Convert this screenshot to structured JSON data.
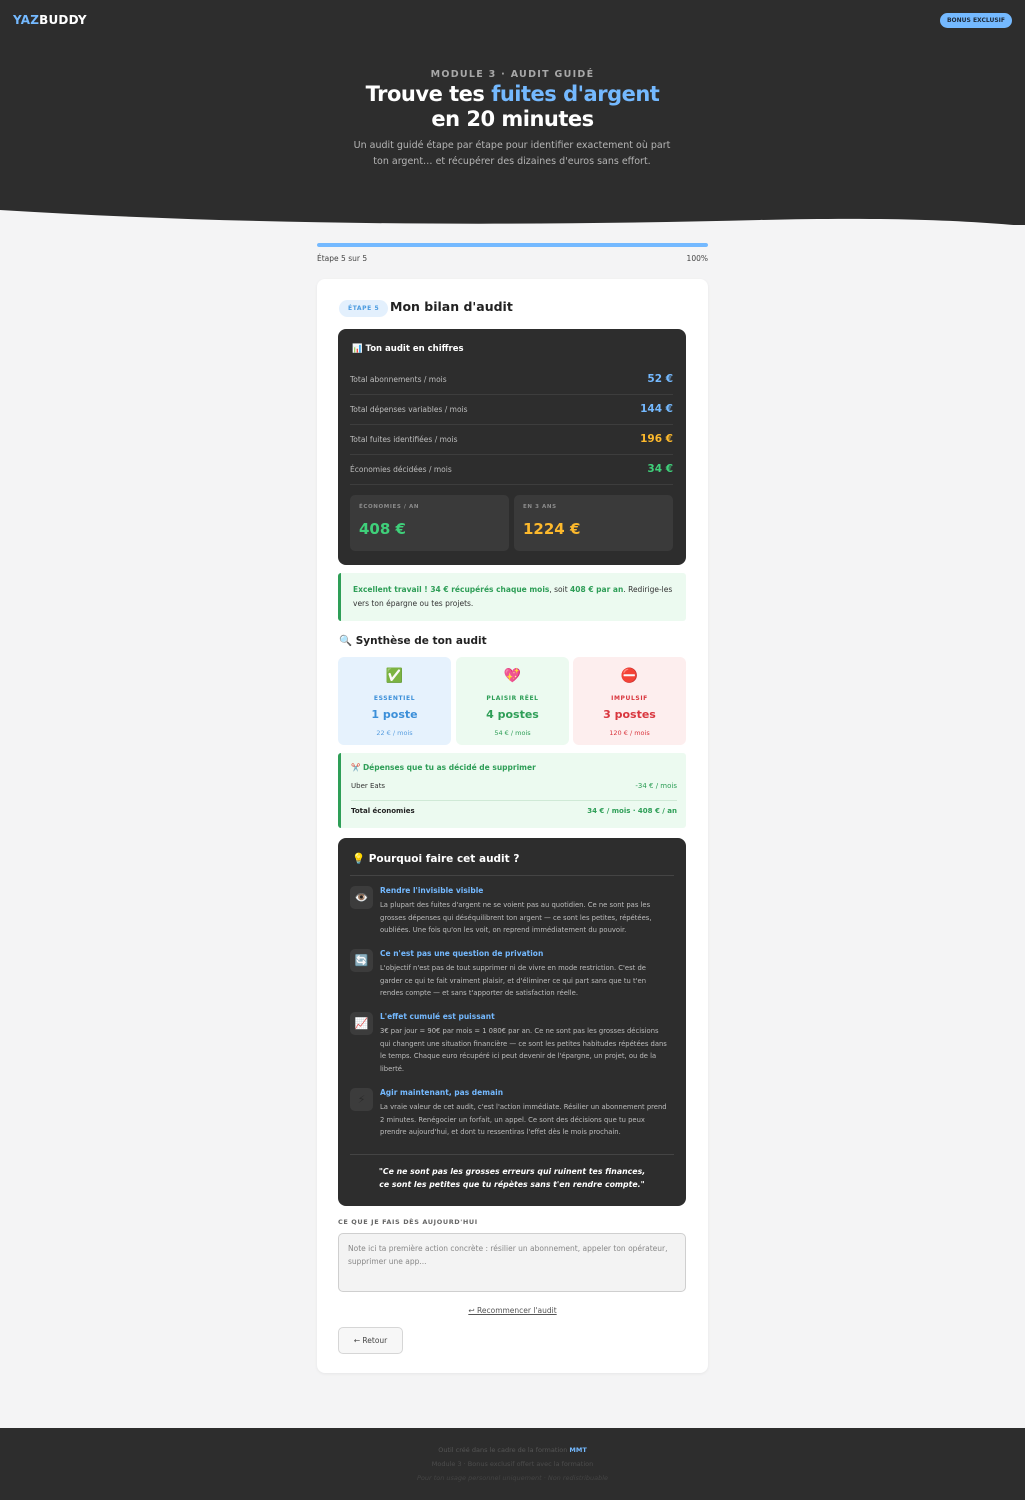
{
  "brand": {
    "part1": "YAZ",
    "part2": "BUDDY"
  },
  "bonus_badge": "BONUS EXCLUSIF",
  "hero": {
    "eyebrow": "MODULE 3 · AUDIT GUIDÉ",
    "title_pre": "Trouve tes ",
    "title_highlight": "fuites d'argent",
    "title_line2": "en 20 minutes",
    "subtitle": "Un audit guidé étape par étape pour identifier exactement où part ton argent… et récupérer des dizaines d'euros sans effort."
  },
  "progress": {
    "label": "Étape 5 sur 5",
    "percent_label": "100%",
    "value": 1.0
  },
  "step": {
    "badge": "ÉTAPE 5",
    "title": "Mon bilan d'audit"
  },
  "figures": {
    "title": "📊 Ton audit en chiffres",
    "rows": [
      {
        "label": "Total abonnements / mois",
        "value": "52 €",
        "color": "#74b9ff"
      },
      {
        "label": "Total dépenses variables / mois",
        "value": "144 €",
        "color": "#74b9ff"
      },
      {
        "label": "Total fuites identifiées / mois",
        "value": "196 €",
        "color": "#fdb92c"
      },
      {
        "label": "Économies décidées / mois",
        "value": "34 €",
        "color": "#3fd07a"
      }
    ],
    "boxes": [
      {
        "caption": "ÉCONOMIES / AN",
        "value": "408 €",
        "color": "#3fd07a"
      },
      {
        "caption": "EN 3 ANS",
        "value": "1224 €",
        "color": "#fdb92c"
      }
    ]
  },
  "success": {
    "bold1": "Excellent travail ! 34 € récupérés chaque mois",
    "mid": ", soit ",
    "bold2": "408 € par an",
    "rest": ". Redirige-les vers ton épargne ou tes projets."
  },
  "synthesis": {
    "title": "🔍 Synthèse de ton audit",
    "tiles": [
      {
        "icon": "✅",
        "icon_name": "check-icon",
        "caption": "ESSENTIEL",
        "count": "1 poste",
        "sub": "22 € / mois",
        "bg": "#e6f2fd",
        "color": "#3b8fd9",
        "sub_color": "#5a9fe0"
      },
      {
        "icon": "💖",
        "icon_name": "heart-icon",
        "caption": "PLAISIR RÉEL",
        "count": "4 postes",
        "sub": "54 € / mois",
        "bg": "#ecfaf0",
        "color": "#2e9e57",
        "sub_color": "#2e9e57"
      },
      {
        "icon": "⛔",
        "icon_name": "no-entry-icon",
        "caption": "IMPULSIF",
        "count": "3 postes",
        "sub": "120 € / mois",
        "bg": "#fdeeee",
        "color": "#d9363e",
        "sub_color": "#d9363e"
      }
    ]
  },
  "removed": {
    "title": "✂️ Dépenses que tu as décidé de supprimer",
    "items": [
      {
        "label": "Uber Eats",
        "value": "-34 € / mois"
      }
    ],
    "total_label": "Total économies",
    "total_value": "34 € / mois · 408 € / an"
  },
  "why": {
    "title": "💡 Pourquoi faire cet audit ?",
    "items": [
      {
        "icon": "👁️",
        "icon_name": "eye-icon",
        "title": "Rendre l'invisible visible",
        "text": "La plupart des fuites d'argent ne se voient pas au quotidien. Ce ne sont pas les grosses dépenses qui déséquilibrent ton argent — ce sont les petites, répétées, oubliées. Une fois qu'on les voit, on reprend immédiatement du pouvoir."
      },
      {
        "icon": "🔄",
        "icon_name": "repeat-icon",
        "title": "Ce n'est pas une question de privation",
        "text": "L'objectif n'est pas de tout supprimer ni de vivre en mode restriction. C'est de garder ce qui te fait vraiment plaisir, et d'éliminer ce qui part sans que tu t'en rendes compte — et sans t'apporter de satisfaction réelle."
      },
      {
        "icon": "📈",
        "icon_name": "chart-up-icon",
        "title": "L'effet cumulé est puissant",
        "text": "3€ par jour = 90€ par mois = 1 080€ par an. Ce ne sont pas les grosses décisions qui changent une situation financière — ce sont les petites habitudes répétées dans le temps. Chaque euro récupéré ici peut devenir de l'épargne, un projet, ou de la liberté."
      },
      {
        "icon": "⚡",
        "icon_name": "lightning-icon",
        "title": "Agir maintenant, pas demain",
        "text": "La vraie valeur de cet audit, c'est l'action immédiate. Résilier un abonnement prend 2 minutes. Renégocier un forfait, un appel. Ce sont des décisions que tu peux prendre aujourd'hui, et dont tu ressentiras l'effet dès le mois prochain."
      }
    ],
    "quote_line1": "\"Ce ne sont pas les grosses erreurs qui ruinent tes finances,",
    "quote_line2": "ce sont les petites que tu répètes sans t'en rendre compte.\""
  },
  "note": {
    "label": "CE QUE JE FAIS DÈS AUJOURD'HUI",
    "placeholder": "Note ici ta première action concrète : résilier un abonnement, appeler ton opérateur, supprimer une app..."
  },
  "restart_label": "↩ Recommencer l'audit",
  "back_label": "← Retour",
  "footer": {
    "line1_pre": "Outil créé dans le cadre de la formation ",
    "line1_brand": "MMT",
    "line2": "Module 3 · Bonus exclusif offert avec la formation",
    "line3": "Pour ton usage personnel uniquement · Non redistribuable"
  }
}
